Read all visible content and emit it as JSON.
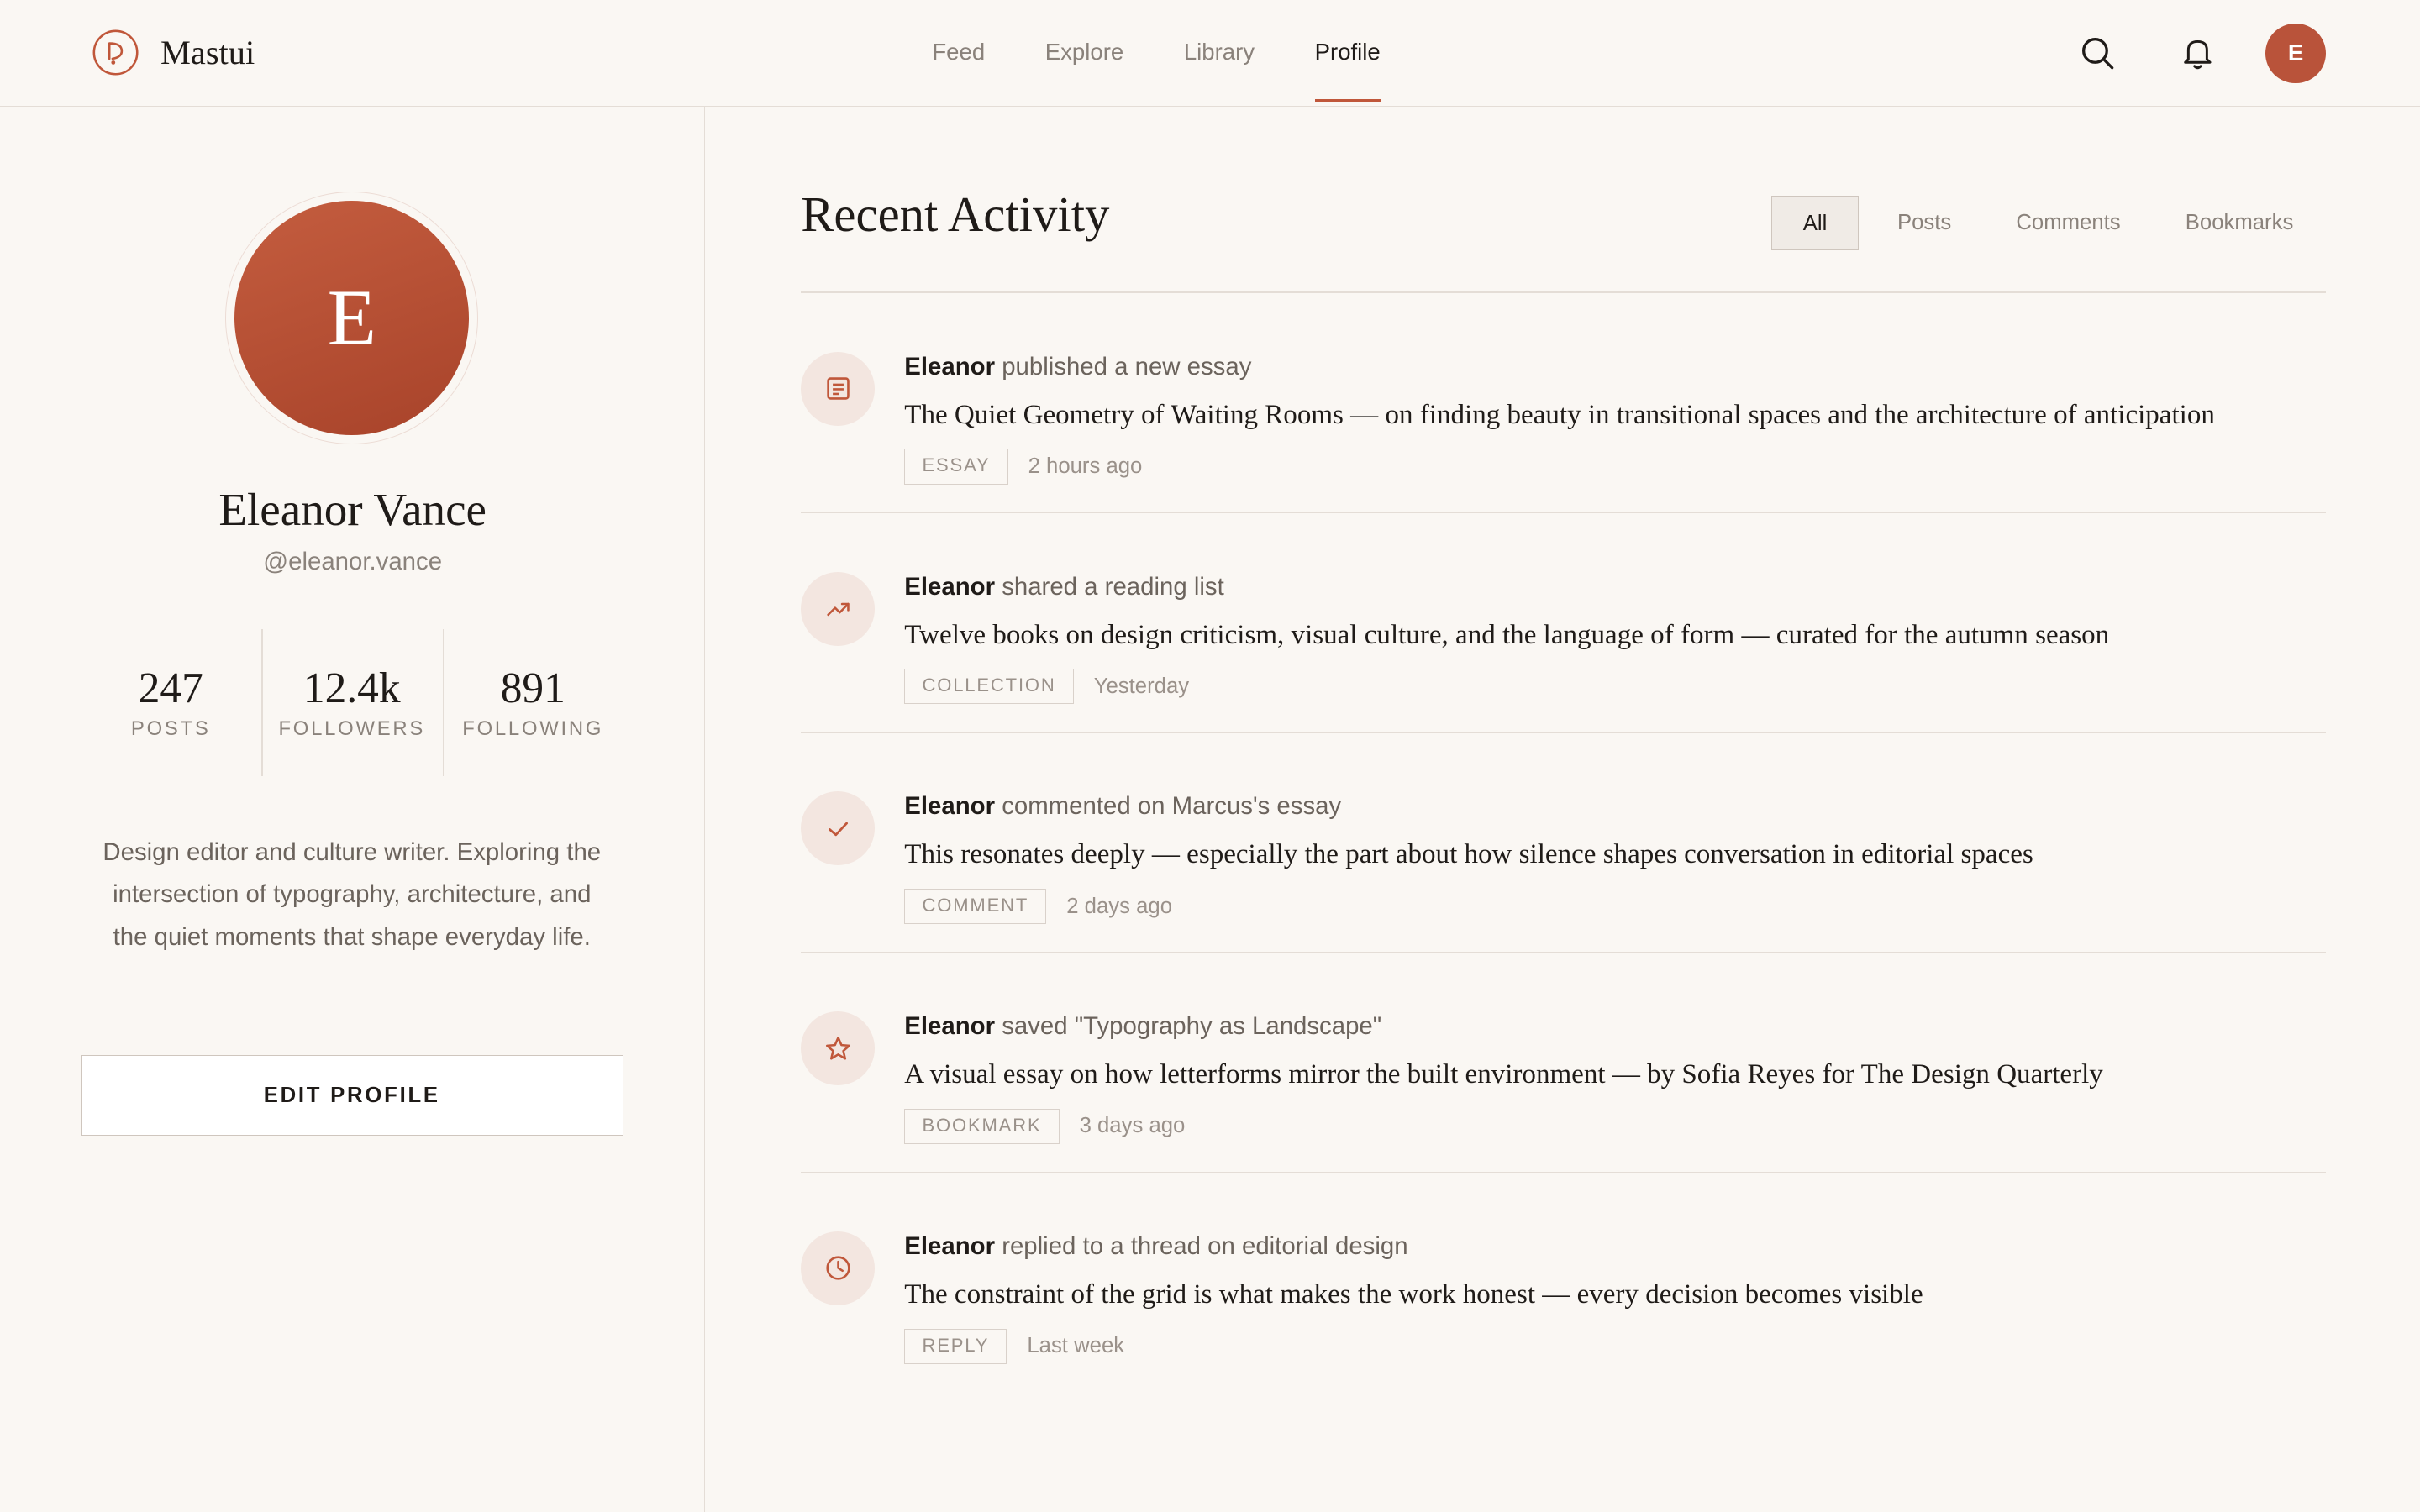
{
  "header": {
    "brand_name": "Mastui",
    "nav": [
      {
        "label": "Feed",
        "active": false
      },
      {
        "label": "Explore",
        "active": false
      },
      {
        "label": "Library",
        "active": false
      },
      {
        "label": "Profile",
        "active": true
      }
    ],
    "search_icon": "search-icon",
    "bell_icon": "bell-icon",
    "avatar_initial": "E"
  },
  "profile": {
    "avatar_initial": "E",
    "name": "Eleanor Vance",
    "handle": "@eleanor.vance",
    "stats": [
      {
        "value": "247",
        "label": "POSTS"
      },
      {
        "value": "12.4k",
        "label": "FOLLOWERS"
      },
      {
        "value": "891",
        "label": "FOLLOWING"
      }
    ],
    "bio": "Design editor and culture writer. Exploring the intersection of typography, architecture, and the quiet moments that shape everyday life.",
    "edit_label": "EDIT PROFILE"
  },
  "activity": {
    "title": "Recent Activity",
    "filters": [
      {
        "label": "All",
        "active": true
      },
      {
        "label": "Posts",
        "active": false
      },
      {
        "label": "Comments",
        "active": false
      },
      {
        "label": "Bookmarks",
        "active": false
      }
    ],
    "items": [
      {
        "icon": "document-icon",
        "actor": "Eleanor",
        "action": " published a new essay",
        "title": "The Quiet Geometry of Waiting Rooms — on finding beauty in transitional spaces and the architecture of anticipation",
        "tag": "ESSAY",
        "time": "2 hours ago"
      },
      {
        "icon": "trending-icon",
        "actor": "Eleanor",
        "action": " shared a reading list",
        "title": "Twelve books on design criticism, visual culture, and the language of form — curated for the autumn season",
        "tag": "COLLECTION",
        "time": "Yesterday"
      },
      {
        "icon": "check-icon",
        "actor": "Eleanor",
        "action": " commented on Marcus's essay",
        "title": "This resonates deeply — especially the part about how silence shapes conversation in editorial spaces",
        "tag": "COMMENT",
        "time": "2 days ago"
      },
      {
        "icon": "star-icon",
        "actor": "Eleanor",
        "action": " saved \"Typography as Landscape\"",
        "title": "A visual essay on how letterforms mirror the built environment — by Sofia Reyes for The Design Quarterly",
        "tag": "BOOKMARK",
        "time": "3 days ago"
      },
      {
        "icon": "clock-icon",
        "actor": "Eleanor",
        "action": " replied to a thread on editorial design",
        "title": "The constraint of the grid is what makes the work honest — every decision becomes visible",
        "tag": "REPLY",
        "time": "Last week"
      }
    ]
  },
  "colors": {
    "accent": "#c0573a",
    "background": "#faf7f3",
    "icon_bg": "#f3e6e0"
  }
}
